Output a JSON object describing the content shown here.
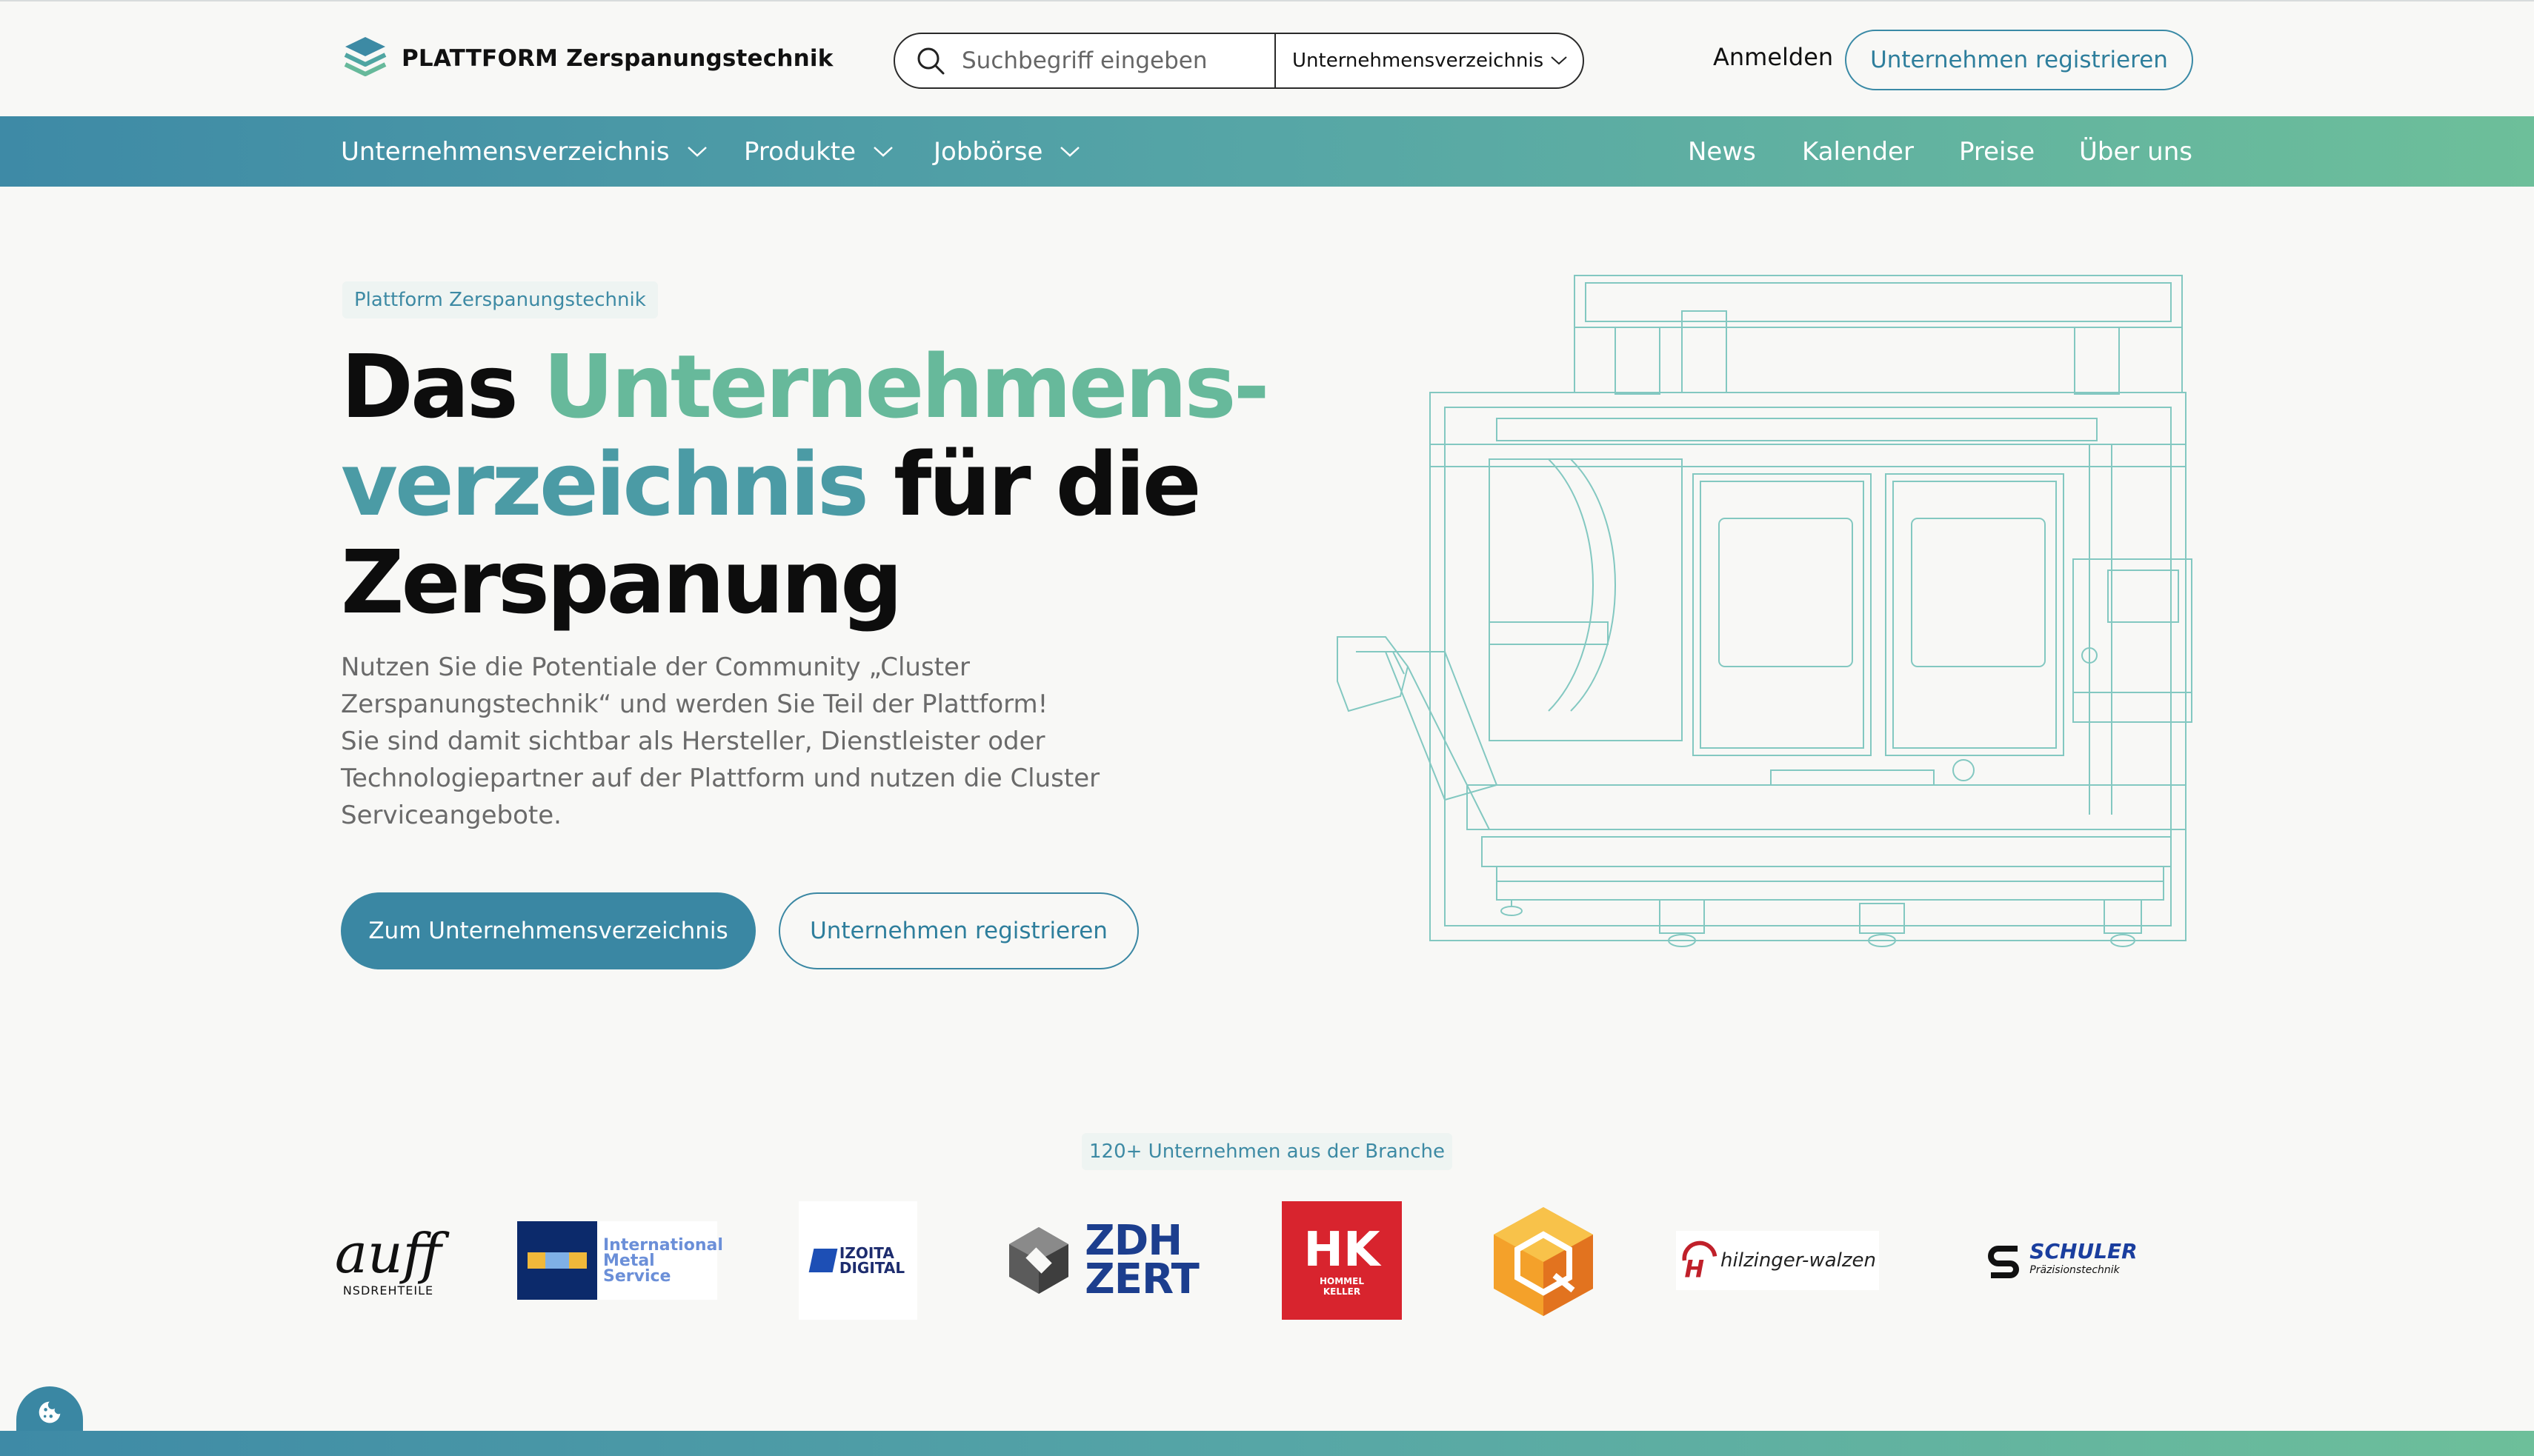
{
  "header": {
    "logo_label": "PLATTFORM Zerspanungstechnik",
    "search_placeholder": "Suchbegriff eingeben",
    "search_scope": "Unternehmensverzeichnis",
    "login_label": "Anmelden",
    "register_label": "Unternehmen registrieren"
  },
  "nav": {
    "left": [
      {
        "label": "Unternehmensverzeichnis",
        "has_dropdown": true
      },
      {
        "label": "Produkte",
        "has_dropdown": true
      },
      {
        "label": "Jobbörse",
        "has_dropdown": true
      }
    ],
    "right": [
      {
        "label": "News"
      },
      {
        "label": "Kalender"
      },
      {
        "label": "Preise"
      },
      {
        "label": "Über uns"
      }
    ]
  },
  "hero": {
    "eyebrow": "Plattform Zerspanungstechnik",
    "title_part1": "Das ",
    "title_part2": "Unternehmens-",
    "title_part3": "verzeichnis",
    "title_part4": " für die",
    "title_part5": "Zerspanung",
    "text_line1": "Nutzen Sie die Potentiale der Community „Cluster",
    "text_line2": "Zerspanungstechnik“ und werden Sie Teil der Plattform!",
    "text_line3": "Sie sind damit sichtbar als Hersteller, Dienstleister oder",
    "text_line4": "Technologiepartner auf der Plattform und nutzen die Cluster",
    "text_line5": "Serviceangebote.",
    "primary_button": "Zum Unternehmensverzeichnis",
    "secondary_button": "Unternehmen registrieren"
  },
  "logos": {
    "tagline": "120+ Unternehmen aus der Branche",
    "items": [
      {
        "name": "auff",
        "sub": "NSDREHTEILE"
      },
      {
        "name": "International Metal Service",
        "line1": "International",
        "line2": "Metal",
        "line3": "Service"
      },
      {
        "name": "IZOITA DIGITAL",
        "line1": "IZOITA",
        "line2": "DIGITAL"
      },
      {
        "name": "ZDH ZERT",
        "line1": "ZDH",
        "line2": "ZERT"
      },
      {
        "name": "Hommel Keller",
        "mark": "HK",
        "line1": "HOMMEL",
        "line2": "KELLER"
      },
      {
        "name": "cube-logo"
      },
      {
        "name": "hilzinger-walzen",
        "mark": "H",
        "text": "hilzinger-walzen"
      },
      {
        "name": "SCHULER",
        "line1": "SCHULER",
        "line2": "Präzisionstechnik"
      }
    ]
  },
  "colors": {
    "accent": "#3a87a3",
    "accent_green": "#67b99b",
    "accent_teal": "#4b9ba5",
    "background": "#f8f8f6"
  }
}
